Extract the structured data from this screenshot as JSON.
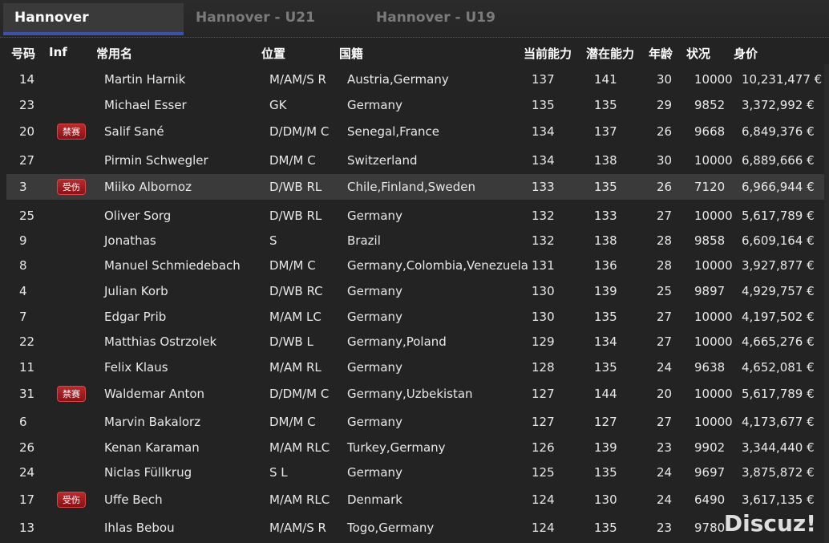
{
  "tabs": [
    {
      "label": "Hannover",
      "active": true
    },
    {
      "label": "Hannover - U21",
      "active": false
    },
    {
      "label": "Hannover - U19",
      "active": false
    }
  ],
  "columns": {
    "no": "号码",
    "inf": "Inf",
    "name": "常用名",
    "pos": "位置",
    "nat": "国籍",
    "ca": "当前能力",
    "pa": "潜在能力",
    "age": "年龄",
    "cond": "状况",
    "value": "身价"
  },
  "players": [
    {
      "no": "14",
      "inf": "",
      "name": "Martin Harnik",
      "pos": "M/AM/S R",
      "nat": "Austria,Germany",
      "ca": "137",
      "pa": "141",
      "age": "30",
      "cond": "10000",
      "value": "10,231,477 €"
    },
    {
      "no": "23",
      "inf": "",
      "name": "Michael Esser",
      "pos": "GK",
      "nat": "Germany",
      "ca": "135",
      "pa": "135",
      "age": "29",
      "cond": "9852",
      "value": "3,372,992 €"
    },
    {
      "no": "20",
      "inf": "禁赛",
      "name": "Salif Sané",
      "pos": "D/DM/M C",
      "nat": "Senegal,France",
      "ca": "134",
      "pa": "137",
      "age": "26",
      "cond": "9668",
      "value": "6,849,376 €"
    },
    {
      "no": "27",
      "inf": "",
      "name": "Pirmin Schwegler",
      "pos": "DM/M C",
      "nat": "Switzerland",
      "ca": "134",
      "pa": "138",
      "age": "30",
      "cond": "10000",
      "value": "6,889,666 €"
    },
    {
      "no": "3",
      "inf": "受伤",
      "name": "Miiko Albornoz",
      "pos": "D/WB RL",
      "nat": "Chile,Finland,Sweden",
      "ca": "133",
      "pa": "135",
      "age": "26",
      "cond": "7120",
      "value": "6,966,944 €",
      "selected": true
    },
    {
      "no": "25",
      "inf": "",
      "name": "Oliver Sorg",
      "pos": "D/WB RL",
      "nat": "Germany",
      "ca": "132",
      "pa": "133",
      "age": "27",
      "cond": "10000",
      "value": "5,617,789 €"
    },
    {
      "no": "9",
      "inf": "",
      "name": "Jonathas",
      "pos": "S",
      "nat": "Brazil",
      "ca": "132",
      "pa": "138",
      "age": "28",
      "cond": "9858",
      "value": "6,609,164 €"
    },
    {
      "no": "8",
      "inf": "",
      "name": "Manuel Schmiedebach",
      "pos": "DM/M C",
      "nat": "Germany,Colombia,Venezuela",
      "ca": "131",
      "pa": "136",
      "age": "28",
      "cond": "10000",
      "value": "3,927,877 €"
    },
    {
      "no": "4",
      "inf": "",
      "name": "Julian Korb",
      "pos": "D/WB RC",
      "nat": "Germany",
      "ca": "130",
      "pa": "139",
      "age": "25",
      "cond": "9897",
      "value": "4,929,757 €"
    },
    {
      "no": "7",
      "inf": "",
      "name": "Edgar Prib",
      "pos": "M/AM LC",
      "nat": "Germany",
      "ca": "130",
      "pa": "135",
      "age": "27",
      "cond": "10000",
      "value": "4,197,502 €"
    },
    {
      "no": "22",
      "inf": "",
      "name": "Matthias Ostrzolek",
      "pos": "D/WB L",
      "nat": "Germany,Poland",
      "ca": "129",
      "pa": "134",
      "age": "27",
      "cond": "10000",
      "value": "4,665,276 €"
    },
    {
      "no": "11",
      "inf": "",
      "name": "Felix Klaus",
      "pos": "M/AM RL",
      "nat": "Germany",
      "ca": "128",
      "pa": "135",
      "age": "24",
      "cond": "9638",
      "value": "4,652,081 €"
    },
    {
      "no": "31",
      "inf": "禁赛",
      "name": "Waldemar Anton",
      "pos": "D/DM/M C",
      "nat": "Germany,Uzbekistan",
      "ca": "127",
      "pa": "144",
      "age": "20",
      "cond": "10000",
      "value": "5,617,789 €"
    },
    {
      "no": "6",
      "inf": "",
      "name": "Marvin Bakalorz",
      "pos": "DM/M C",
      "nat": "Germany",
      "ca": "127",
      "pa": "127",
      "age": "27",
      "cond": "10000",
      "value": "4,173,677 €"
    },
    {
      "no": "26",
      "inf": "",
      "name": "Kenan Karaman",
      "pos": "M/AM RLC",
      "nat": "Turkey,Germany",
      "ca": "126",
      "pa": "139",
      "age": "23",
      "cond": "9902",
      "value": "3,344,440 €"
    },
    {
      "no": "24",
      "inf": "",
      "name": "Niclas Füllkrug",
      "pos": "S L",
      "nat": "Germany",
      "ca": "125",
      "pa": "135",
      "age": "24",
      "cond": "9697",
      "value": "3,875,872 €"
    },
    {
      "no": "17",
      "inf": "受伤",
      "name": "Uffe Bech",
      "pos": "M/AM RLC",
      "nat": "Denmark",
      "ca": "124",
      "pa": "130",
      "age": "24",
      "cond": "6490",
      "value": "3,617,135 €"
    },
    {
      "no": "13",
      "inf": "",
      "name": "Ihlas Bebou",
      "pos": "M/AM/S R",
      "nat": "Togo,Germany",
      "ca": "124",
      "pa": "135",
      "age": "23",
      "cond": "9780",
      "value": ""
    }
  ],
  "watermark": "Discuz!"
}
